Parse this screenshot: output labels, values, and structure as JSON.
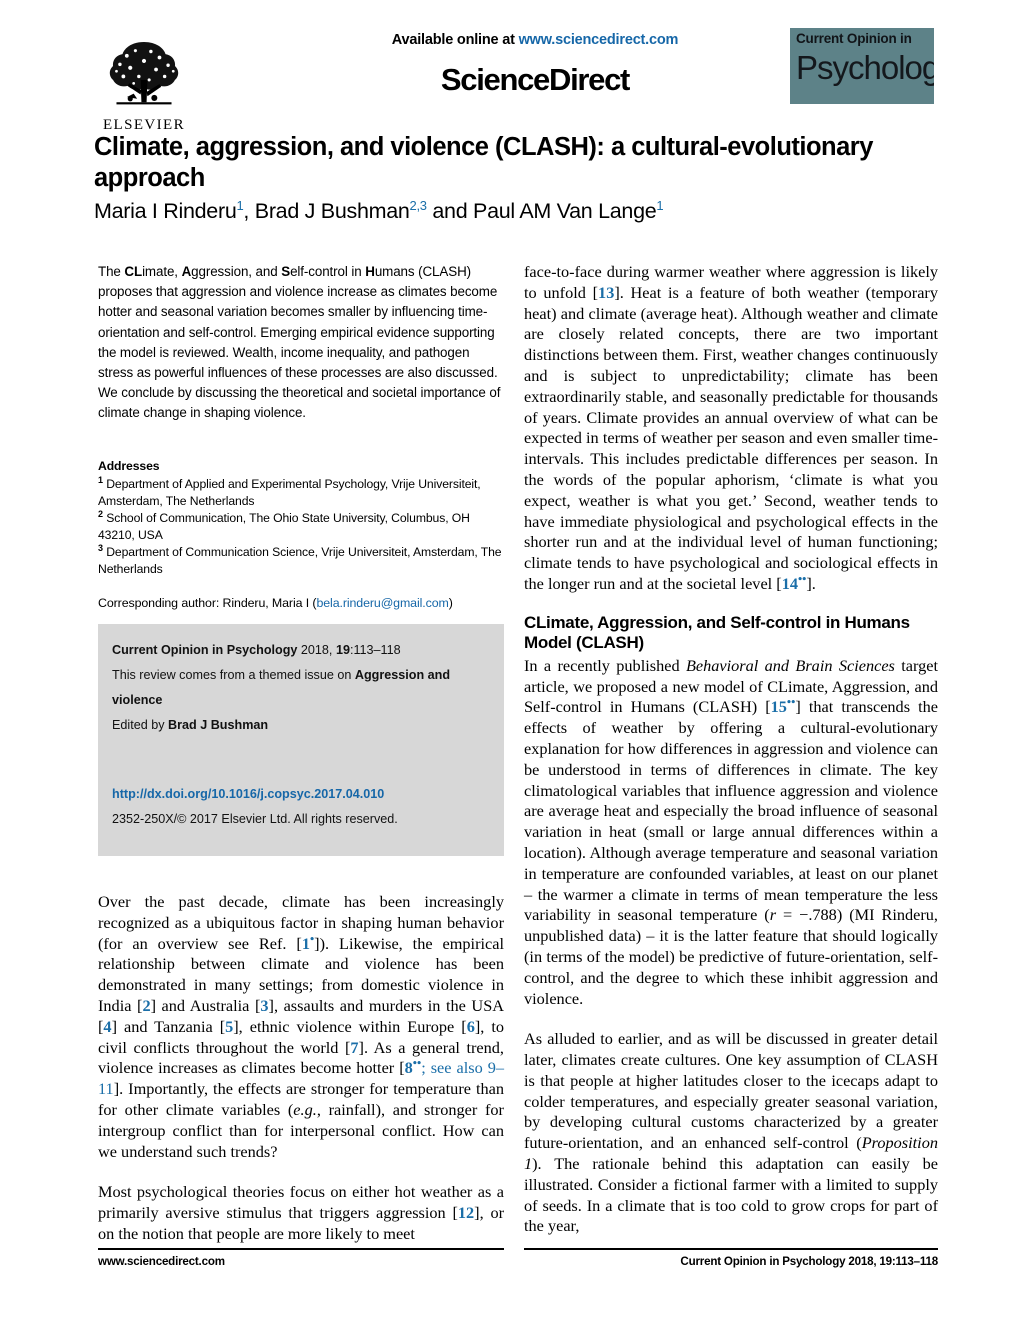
{
  "masthead": {
    "available_prefix": "Available online at ",
    "available_url": "www.sciencedirect.com",
    "sciencedirect_wordmark": "ScienceDirect",
    "publisher_name": "ELSEVIER",
    "journal_logo_line1": "Current Opinion in",
    "journal_logo_line2": "Psychology",
    "journal_logo_bg": "#5d8288",
    "link_color": "#1667a8"
  },
  "article": {
    "title": "Climate, aggression, and violence (CLASH): a cultural-evolutionary approach",
    "authors": [
      {
        "name": "Maria I Rinderu",
        "affiliation": "1"
      },
      {
        "name": "Brad J Bushman",
        "affiliation": "2,3"
      },
      {
        "name": "Paul AM Van Lange",
        "affiliation": "1"
      }
    ],
    "author_separator_last": " and "
  },
  "abstract": {
    "part1": "The ",
    "bold1": "CL",
    "part2": "imate, ",
    "bold2": "A",
    "part3": "ggression, and ",
    "bold3": "S",
    "part4": "elf-control in ",
    "bold4": "H",
    "part5": "umans (CLASH) proposes that aggression and violence increase as climates become hotter and seasonal variation becomes smaller by influencing time-orientation and self-control. Emerging empirical evidence supporting the model is reviewed. Wealth, income inequality, and pathogen stress as powerful influences of these processes are also discussed. We conclude by discussing the theoretical and societal importance of climate change in shaping violence."
  },
  "addresses": {
    "heading": "Addresses",
    "items": [
      {
        "num": "1",
        "text": "Department of Applied and Experimental Psychology, Vrije Universiteit, Amsterdam, The Netherlands"
      },
      {
        "num": "2",
        "text": "School of Communication, The Ohio State University, Columbus, OH 43210, USA"
      },
      {
        "num": "3",
        "text": "Department of Communication Science, Vrije Universiteit, Amsterdam, The Netherlands"
      }
    ],
    "corresponding_label": "Corresponding author: Rinderu, Maria I (",
    "corresponding_email": "bela.rinderu@gmail.com",
    "corresponding_close": ")"
  },
  "citation_box": {
    "journal_bold": "Current Opinion in Psychology",
    "citation_plain": " 2018, ",
    "volume_bold": "19",
    "pages": ":113–118",
    "themed_prefix": "This review comes from a themed issue on ",
    "themed_bold": "Aggression and violence",
    "edited_prefix": "Edited by ",
    "edited_bold": "Brad J Bushman",
    "doi": "http://dx.doi.org/10.1016/j.copsyc.2017.04.010",
    "copyright": "2352-250X/© 2017 Elsevier Ltd. All rights reserved.",
    "bg_color": "#d7d7d7"
  },
  "body": {
    "left_paragraphs": [
      {
        "segments": [
          {
            "t": "Over the past decade, climate has been increasingly recognized as a ubiquitous factor in shaping human behavior (for an overview see Ref. ["
          },
          {
            "t": "1",
            "style": "ref-bold"
          },
          {
            "t": "•",
            "style": "ref-star"
          },
          {
            "t": "]). Likewise, the empirical relationship between climate and violence has been demonstrated in many settings; from domestic violence in India ["
          },
          {
            "t": "2",
            "style": "ref-bold"
          },
          {
            "t": "] and Australia ["
          },
          {
            "t": "3",
            "style": "ref-bold"
          },
          {
            "t": "], assaults and murders in the USA ["
          },
          {
            "t": "4",
            "style": "ref-bold"
          },
          {
            "t": "] and Tanzania ["
          },
          {
            "t": "5",
            "style": "ref-bold"
          },
          {
            "t": "], ethnic violence within Europe ["
          },
          {
            "t": "6",
            "style": "ref-bold"
          },
          {
            "t": "], to civil conflicts throughout the world ["
          },
          {
            "t": "7",
            "style": "ref-bold"
          },
          {
            "t": "]. As a general trend, violence increases as climates become hotter ["
          },
          {
            "t": "8",
            "style": "ref-bold"
          },
          {
            "t": "••",
            "style": "ref-star"
          },
          {
            "t": "; see also 9–11",
            "style": "ref"
          },
          {
            "t": "]. Importantly, the effects are stronger for temperature than for other climate variables ("
          },
          {
            "t": "e.g.",
            "style": "italic"
          },
          {
            "t": ", rainfall), and stronger for intergroup conflict than for interpersonal conflict. How can we understand such trends?"
          }
        ]
      },
      {
        "segments": [
          {
            "t": "Most psychological theories focus on either hot weather as a primarily aversive stimulus that triggers aggression ["
          },
          {
            "t": "12",
            "style": "ref-bold"
          },
          {
            "t": "], or on the notion that people are more likely to meet"
          }
        ]
      }
    ],
    "right_paragraphs": [
      {
        "segments": [
          {
            "t": "face-to-face during warmer weather where aggression is likely to unfold ["
          },
          {
            "t": "13",
            "style": "ref-bold"
          },
          {
            "t": "]. Heat is a feature of both weather (temporary heat) and climate (average heat). Although weather and climate are closely related concepts, there are two important distinctions between them. First, weather changes continuously and is subject to unpredictability; climate has been extraordinarily stable, and seasonally predictable for thousands of years. Climate provides an annual overview of what can be expected in terms of weather per season and even smaller time-intervals. This includes predictable differences per season. In the words of the popular aphorism, ‘climate is what you expect, weather is what you get.’ Second, weather tends to have immediate physiological and psychological effects in the shorter run and at the individual level of human functioning; climate tends to have psychological and sociological effects in the longer run and at the societal level ["
          },
          {
            "t": "14",
            "style": "ref-bold"
          },
          {
            "t": "••",
            "style": "ref-star"
          },
          {
            "t": "]."
          }
        ]
      }
    ],
    "right_section_heading": "CLimate, Aggression, and Self-control in Humans Model (CLASH)",
    "right_section_paragraphs": [
      {
        "segments": [
          {
            "t": "In a recently published "
          },
          {
            "t": "Behavioral and Brain Sciences",
            "style": "italic"
          },
          {
            "t": " target article, we proposed a new model of CLimate, Aggression, and Self-control in Humans (CLASH) ["
          },
          {
            "t": "15",
            "style": "ref-bold"
          },
          {
            "t": "••",
            "style": "ref-star"
          },
          {
            "t": "] that transcends the effects of weather by offering a cultural-evolutionary explanation for how differences in aggression and violence can be understood in terms of differences in climate. The key climatological variables that influence aggression and violence are average heat and especially the broad influence of seasonal variation in heat (small or large annual differences within a location). Although average temperature and seasonal variation in temperature are confounded variables, at least on our planet – the warmer a climate in terms of mean temperature the less variability in seasonal temperature ("
          },
          {
            "t": "r",
            "style": "italic"
          },
          {
            "t": " = −.788) (MI Rinderu, unpublished data) – it is the latter feature that should logically (in terms of the model) be predictive of future-orientation, self-control, and the degree to which these inhibit aggression and violence."
          }
        ]
      },
      {
        "segments": [
          {
            "t": "As alluded to earlier, and as will be discussed in greater detail later, climates create cultures. One key assumption of CLASH is that people at higher latitudes closer to the icecaps adapt to colder temperatures, and especially greater seasonal variation, by developing cultural customs characterized by a greater future-orientation, and an enhanced self-control ("
          },
          {
            "t": "Proposition 1",
            "style": "italic"
          },
          {
            "t": "). The rationale behind this adaptation can easily be illustrated. Consider a fictional farmer with a limited to supply of seeds. In a climate that is too cold to grow crops for part of the year,"
          }
        ]
      }
    ]
  },
  "footer": {
    "left": "www.sciencedirect.com",
    "right": "Current Opinion in Psychology 2018, 19:113–118"
  }
}
